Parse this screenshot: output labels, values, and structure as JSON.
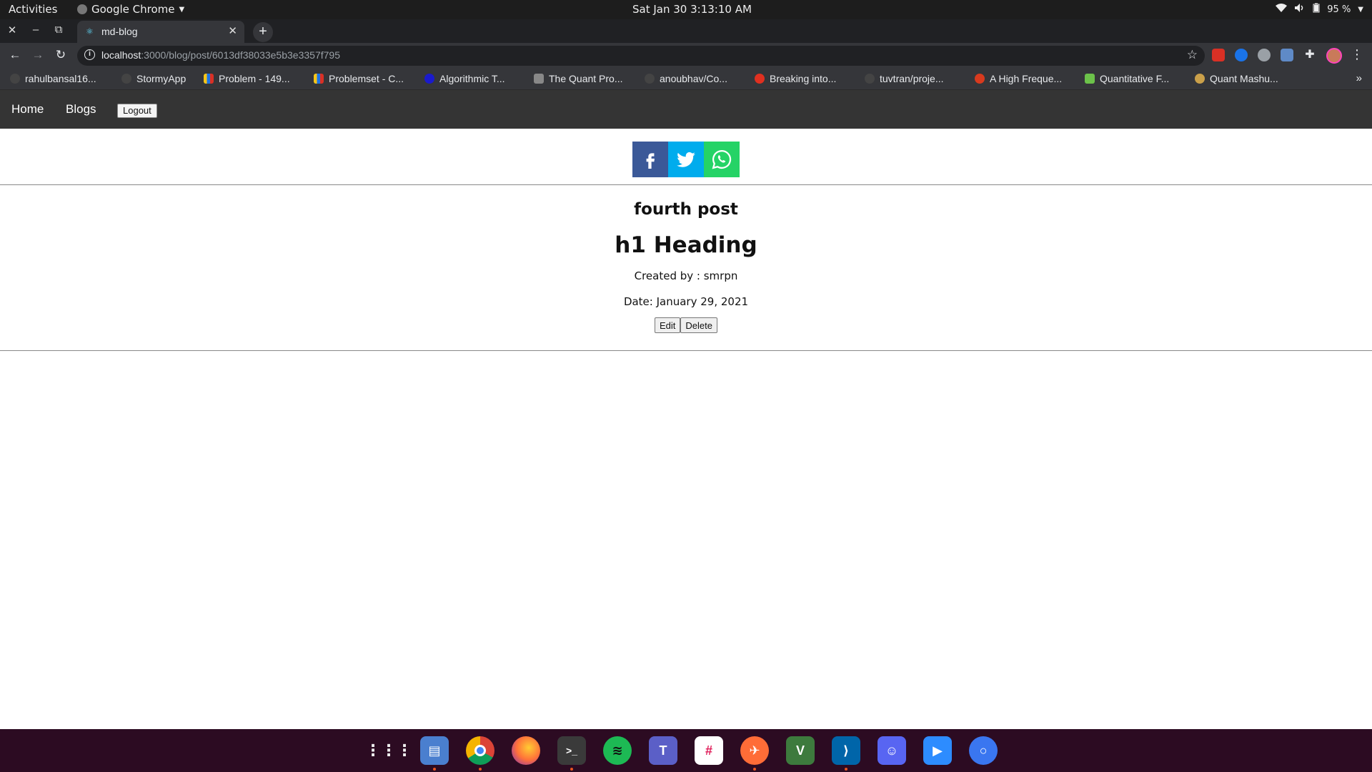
{
  "system": {
    "activities": "Activities",
    "app_name": "Google Chrome",
    "clock": "Sat Jan 30  3:13:10 AM",
    "battery": "95 %"
  },
  "browser": {
    "tab_title": "md-blog",
    "url_host": "localhost",
    "url_rest": ":3000/blog/post/6013df38033e5b3e3357f795",
    "bookmarks": [
      {
        "label": "rahulbansal16...",
        "color": "#444"
      },
      {
        "label": "StormyApp",
        "color": "#444"
      },
      {
        "label": "Problem - 149...",
        "color": "#3b6ed8"
      },
      {
        "label": "Problemset - C...",
        "color": "#3b6ed8"
      },
      {
        "label": "Algorithmic T...",
        "color": "#1a1acc"
      },
      {
        "label": "The Quant Pro...",
        "color": "#888"
      },
      {
        "label": "anoubhav/Co...",
        "color": "#444"
      },
      {
        "label": "Breaking into...",
        "color": "#e03020"
      },
      {
        "label": "tuvtran/proje...",
        "color": "#444"
      },
      {
        "label": "A High Freque...",
        "color": "#d83a1e"
      },
      {
        "label": "Quantitative F...",
        "color": "#6cc24a"
      },
      {
        "label": "Quant Mashu...",
        "color": "#caa04a"
      }
    ]
  },
  "nav": {
    "home": "Home",
    "blogs": "Blogs",
    "logout": "Logout"
  },
  "post": {
    "title": "fourth post",
    "heading": "h1 Heading",
    "created_by": "Created by : smrpn",
    "date": "Date: January 29, 2021",
    "edit": "Edit",
    "delete": "Delete"
  },
  "share": [
    "facebook-icon",
    "twitter-icon",
    "whatsapp-icon"
  ],
  "colors": {
    "facebook": "#3b5998",
    "twitter": "#00aced",
    "whatsapp": "#25d366",
    "navbar": "#343434",
    "dock": "#2c0b22"
  },
  "dock_apps": [
    "app-grid-icon",
    "files-icon",
    "chrome-icon",
    "firefox-icon",
    "terminal-icon",
    "spotify-icon",
    "teams-icon",
    "slack-icon",
    "postman-icon",
    "vim-icon",
    "vscode-icon",
    "discord-icon",
    "zoom-icon",
    "signal-icon"
  ]
}
